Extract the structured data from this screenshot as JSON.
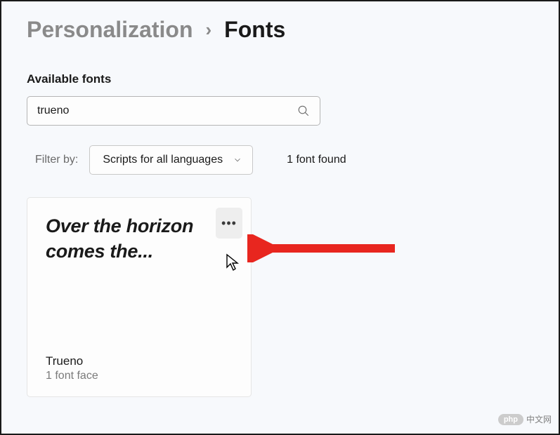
{
  "breadcrumb": {
    "parent": "Personalization",
    "separator": "›",
    "current": "Fonts"
  },
  "section_label": "Available fonts",
  "search": {
    "value": "trueno",
    "placeholder": ""
  },
  "filter": {
    "label": "Filter by:",
    "selected": "Scripts for all languages"
  },
  "result_count": "1 font found",
  "font_card": {
    "preview_text": "Over the horizon comes the...",
    "name": "Trueno",
    "faces": "1 font face"
  },
  "watermark": {
    "badge": "php",
    "text": "中文网"
  }
}
